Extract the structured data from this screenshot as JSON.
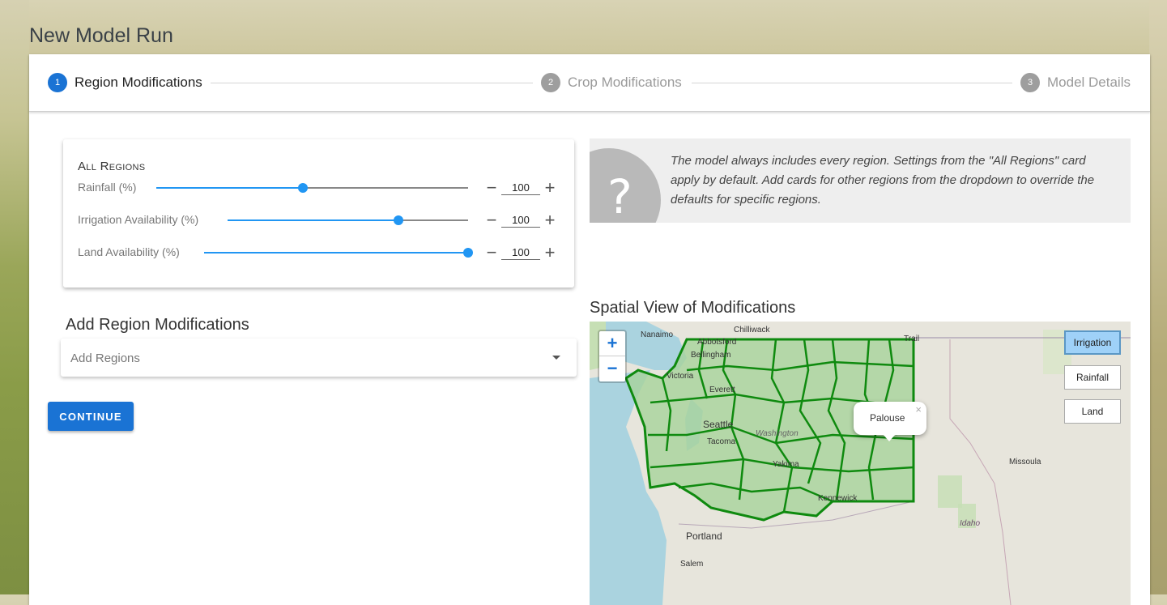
{
  "page_title": "New Model Run",
  "stepper": {
    "steps": [
      {
        "num": "1",
        "label": "Region Modifications",
        "state": "active"
      },
      {
        "num": "2",
        "label": "Crop Modifications",
        "state": "inactive"
      },
      {
        "num": "3",
        "label": "Model Details",
        "state": "inactive"
      }
    ]
  },
  "all_regions": {
    "title": "All Regions",
    "sliders": [
      {
        "label": "Rainfall (%)",
        "value": "100",
        "slider_fraction": 0.47
      },
      {
        "label": "Irrigation Availability (%)",
        "value": "100",
        "slider_fraction": 0.71
      },
      {
        "label": "Land Availability (%)",
        "value": "100",
        "slider_fraction": 1.0
      }
    ],
    "minus_symbol": "−",
    "plus_symbol": "+"
  },
  "add_region": {
    "heading": "Add Region Modifications",
    "dropdown_placeholder": "Add Regions"
  },
  "continue_label": "CONTINUE",
  "info": {
    "icon": "question-mark",
    "qmark": "?",
    "text": "The model always includes every region. Settings from the \"All Regions\" card apply by default. Add cards for other regions from the dropdown to override the defaults for specific regions."
  },
  "map": {
    "heading": "Spatial View of Modifications",
    "zoom_in": "+",
    "zoom_out": "−",
    "layer_buttons": [
      {
        "label": "Irrigation",
        "selected": true
      },
      {
        "label": "Rainfall",
        "selected": false
      },
      {
        "label": "Land",
        "selected": false
      }
    ],
    "popup_text": "Palouse",
    "popup_close": "×",
    "place_labels": {
      "nanaimo": "Nanaimo",
      "chilliwack": "Chilliwack",
      "abbotsford": "Abbotsford",
      "bellingham": "Bellingham",
      "victoria": "Victoria",
      "everett": "Everett",
      "seattle": "Seattle",
      "tacoma": "Tacoma",
      "washington": "Washington",
      "yakima": "Yakima",
      "kennewick": "Kennewick",
      "missoula": "Missoula",
      "portland": "Portland",
      "salem": "Salem",
      "idaho": "Idaho",
      "trail": "Trail"
    },
    "colors": {
      "region_fill": "#a8d39b",
      "region_stroke": "#0f8a0f",
      "water": "#aad3df"
    }
  }
}
